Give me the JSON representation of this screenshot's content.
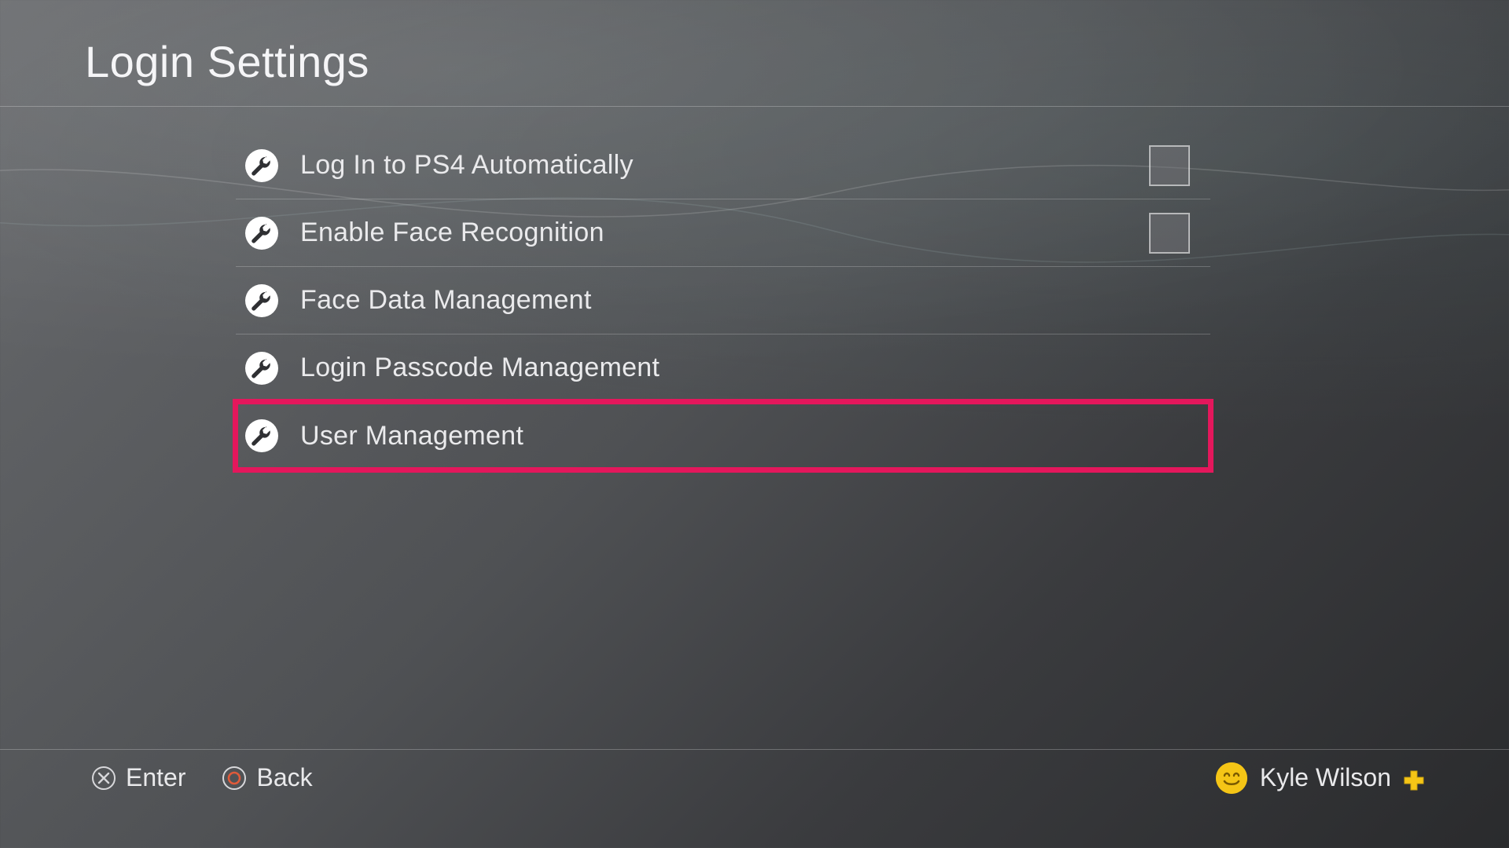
{
  "header": {
    "title": "Login Settings"
  },
  "menu": {
    "items": [
      {
        "label": "Log In to PS4 Automatically",
        "checkbox": true
      },
      {
        "label": "Enable Face Recognition",
        "checkbox": true
      },
      {
        "label": "Face Data Management",
        "checkbox": false
      },
      {
        "label": "Login Passcode Management",
        "checkbox": false
      },
      {
        "label": "User Management",
        "checkbox": false,
        "highlighted": true
      }
    ]
  },
  "footer": {
    "enter_label": "Enter",
    "back_label": "Back",
    "user_name": "Kyle Wilson"
  }
}
